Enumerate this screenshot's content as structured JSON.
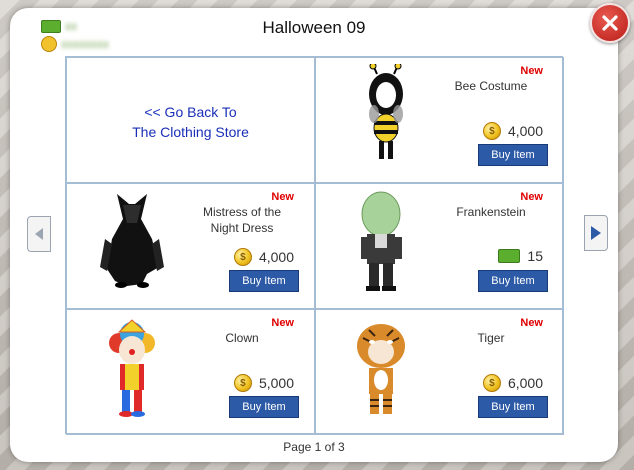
{
  "dialog": {
    "title": "Halloween 09",
    "wallet": {
      "cash_blurred": "xx",
      "coins_blurred": "xxxxxxxx"
    },
    "back_link_line1": "<< Go Back To",
    "back_link_line2": "The Clothing Store",
    "page_label": "Page 1 of 3"
  },
  "items": [
    {
      "new_label": "New",
      "name_line1": "Bee Costume",
      "name_line2": "",
      "price": "4,000",
      "currency": "coin",
      "buy_label": "Buy Item"
    },
    {
      "new_label": "New",
      "name_line1": "Mistress of the",
      "name_line2": "Night Dress",
      "price": "4,000",
      "currency": "coin",
      "buy_label": "Buy Item"
    },
    {
      "new_label": "New",
      "name_line1": "Frankenstein",
      "name_line2": "",
      "price": "15",
      "currency": "cash",
      "buy_label": "Buy Item"
    },
    {
      "new_label": "New",
      "name_line1": "Clown",
      "name_line2": "",
      "price": "5,000",
      "currency": "coin",
      "buy_label": "Buy Item"
    },
    {
      "new_label": "New",
      "name_line1": "Tiger",
      "name_line2": "",
      "price": "6,000",
      "currency": "coin",
      "buy_label": "Buy Item"
    }
  ],
  "colors": {
    "buy_button": "#2d5aa6",
    "new_badge": "#e00000",
    "close_button": "#c62a22",
    "link": "#1a2fb8",
    "cell_border": "#a5bdd4"
  },
  "icons": {
    "close": "close-icon",
    "prev": "arrow-left-icon",
    "next": "arrow-right-icon",
    "coin": "coin-icon",
    "cash": "cash-icon"
  }
}
